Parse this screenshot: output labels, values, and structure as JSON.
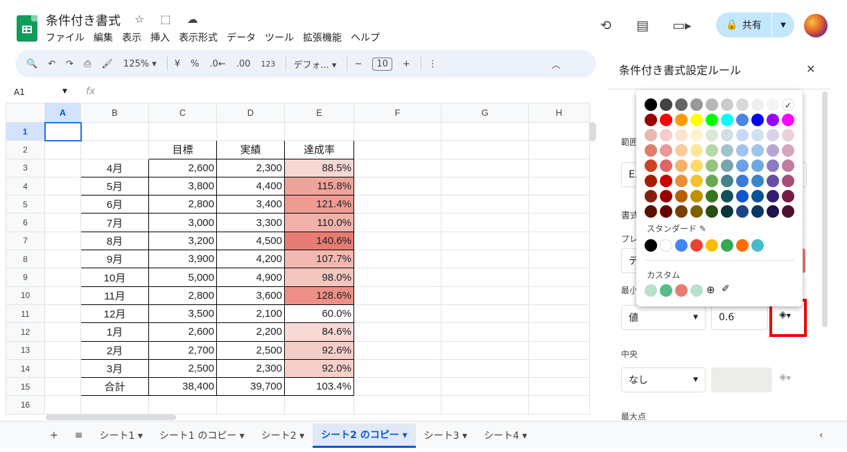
{
  "doc_title": "条件付き書式",
  "title_icons": "☆ ⬚ ☁",
  "menu": [
    "ファイル",
    "編集",
    "表示",
    "挿入",
    "表示形式",
    "データ",
    "ツール",
    "拡張機能",
    "ヘルプ"
  ],
  "share_label": "共有",
  "toolbar": {
    "zoom": "125%",
    "currency": "¥",
    "percent": "%",
    "dec_dec": ".0←",
    "dec_inc": ".00",
    "format_123": "123",
    "font": "デフォ...",
    "font_size": "10"
  },
  "namebox": "A1",
  "fx": "fx",
  "columns": [
    "",
    "A",
    "B",
    "C",
    "D",
    "E",
    "F",
    "G",
    "H"
  ],
  "rows": [
    {
      "n": "1",
      "B": "",
      "C": "",
      "D": "",
      "E": ""
    },
    {
      "n": "2",
      "B": "",
      "C": "目標",
      "D": "実績",
      "E": "達成率"
    },
    {
      "n": "3",
      "B": "4月",
      "C": "2,600",
      "D": "2,300",
      "E": "88.5%",
      "bg": "#f6d7d3"
    },
    {
      "n": "4",
      "B": "5月",
      "C": "3,800",
      "D": "4,400",
      "E": "115.8%",
      "bg": "#efa49b"
    },
    {
      "n": "5",
      "B": "6月",
      "C": "2,800",
      "D": "3,400",
      "E": "121.4%",
      "bg": "#ee9c92"
    },
    {
      "n": "6",
      "B": "7月",
      "C": "3,000",
      "D": "3,300",
      "E": "110.0%",
      "bg": "#f1b1a9"
    },
    {
      "n": "7",
      "B": "8月",
      "C": "3,200",
      "D": "4,500",
      "E": "140.6%",
      "bg": "#e67c73"
    },
    {
      "n": "8",
      "B": "9月",
      "C": "3,900",
      "D": "4,200",
      "E": "107.7%",
      "bg": "#f2b8b1"
    },
    {
      "n": "9",
      "B": "10月",
      "C": "5,000",
      "D": "4,900",
      "E": "98.0%",
      "bg": "#f4c6c0"
    },
    {
      "n": "10",
      "B": "11月",
      "C": "2,800",
      "D": "3,600",
      "E": "128.6%",
      "bg": "#ec9087"
    },
    {
      "n": "11",
      "B": "12月",
      "C": "3,500",
      "D": "2,100",
      "E": "60.0%",
      "bg": "#ffffff"
    },
    {
      "n": "12",
      "B": "1月",
      "C": "2,600",
      "D": "2,200",
      "E": "84.6%",
      "bg": "#f7dad6"
    },
    {
      "n": "13",
      "B": "2月",
      "C": "2,700",
      "D": "2,500",
      "E": "92.6%",
      "bg": "#f5cdc8"
    },
    {
      "n": "14",
      "B": "3月",
      "C": "2,500",
      "D": "2,300",
      "E": "92.0%",
      "bg": "#f5cfca"
    },
    {
      "n": "15",
      "B": "合計",
      "C": "38,400",
      "D": "39,700",
      "E": "103.4%",
      "bg": "#ffffff"
    },
    {
      "n": "16",
      "B": "",
      "C": "",
      "D": "",
      "E": ""
    }
  ],
  "sheet_tabs": [
    "シート1",
    "シート1 のコピー",
    "シート2",
    "シート2 のコピー",
    "シート3",
    "シート4"
  ],
  "active_tab": "シート2 のコピー",
  "panel": {
    "title": "条件付き書式設定ルール",
    "range_label": "範囲",
    "range_value": "E3",
    "format_label": "書式",
    "preview_label": "プレ",
    "preview_value": "デ",
    "min_label": "最小",
    "min_type": "値",
    "min_value": "0.6",
    "mid_label": "中央",
    "mid_type": "なし",
    "max_label": "最大点"
  },
  "palette": {
    "rows": [
      [
        "#000000",
        "#434343",
        "#666666",
        "#999999",
        "#b7b7b7",
        "#cccccc",
        "#d9d9d9",
        "#efefef",
        "#f3f3f3",
        "#ffffff"
      ],
      [
        "#980000",
        "#ff0000",
        "#ff9900",
        "#ffff00",
        "#00ff00",
        "#00ffff",
        "#4a86e8",
        "#0000ff",
        "#9900ff",
        "#ff00ff"
      ],
      [
        "#e6b8af",
        "#f4cccc",
        "#fce5cd",
        "#fff2cc",
        "#d9ead3",
        "#d0e0e3",
        "#c9daf8",
        "#cfe2f3",
        "#d9d2e9",
        "#ead1dc"
      ],
      [
        "#dd7e6b",
        "#ea9999",
        "#f9cb9c",
        "#ffe599",
        "#b6d7a8",
        "#a2c4c9",
        "#a4c2f4",
        "#9fc5e8",
        "#b4a7d6",
        "#d5a6bd"
      ],
      [
        "#cc4125",
        "#e06666",
        "#f6b26b",
        "#ffd966",
        "#93c47d",
        "#76a5af",
        "#6d9eeb",
        "#6fa8dc",
        "#8e7cc3",
        "#c27ba0"
      ],
      [
        "#a61c00",
        "#cc0000",
        "#e69138",
        "#f1c232",
        "#6aa84f",
        "#45818e",
        "#3c78d8",
        "#3d85c6",
        "#674ea7",
        "#a64d79"
      ],
      [
        "#85200c",
        "#990000",
        "#b45f06",
        "#bf9000",
        "#38761d",
        "#134f5c",
        "#1155cc",
        "#0b5394",
        "#351c75",
        "#741b47"
      ],
      [
        "#5b0f00",
        "#660000",
        "#783f04",
        "#7f6000",
        "#274e13",
        "#0c343d",
        "#1c4587",
        "#073763",
        "#20124d",
        "#4c1130"
      ]
    ],
    "standard_label": "スタンダード",
    "standard": [
      "#000000",
      "#ffffff",
      "#4285f4",
      "#ea4335",
      "#fbbc04",
      "#34a853",
      "#ff6d01",
      "#46bdc6"
    ],
    "custom_label": "カスタム",
    "custom": [
      "#b7e1cd",
      "#57bb8a",
      "#e67c73",
      "#b7e1cd"
    ]
  }
}
